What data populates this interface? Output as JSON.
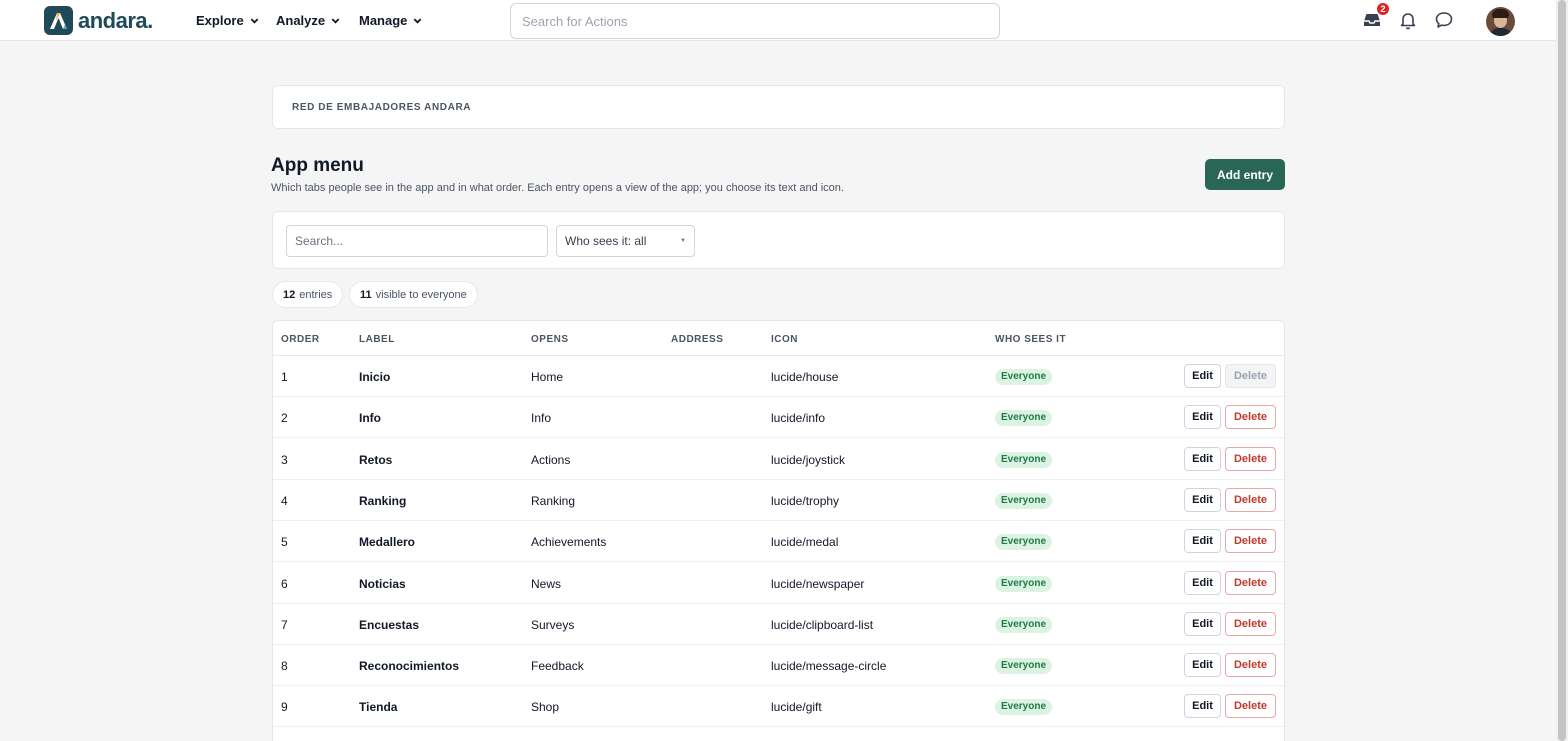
{
  "brand": {
    "name": "andara."
  },
  "nav": {
    "items": [
      {
        "label": "Explore",
        "key": "explore"
      },
      {
        "label": "Analyze",
        "key": "analyze"
      },
      {
        "label": "Manage",
        "key": "manage"
      }
    ],
    "search_placeholder": "Search for Actions",
    "inbox_badge": "2",
    "icons": [
      "inbox-icon",
      "bell-icon",
      "chat-icon"
    ]
  },
  "breadcrumb": {
    "label": "RED DE EMBAJADORES ANDARA"
  },
  "page": {
    "title": "App menu",
    "description": "Which tabs people see in the app and in what order. Each entry opens a view of the app; you choose its text and icon.",
    "add_button": "Add entry"
  },
  "filters": {
    "search_placeholder": "Search...",
    "who_select": "Who sees it: all"
  },
  "stats": {
    "entries_count": "12",
    "entries_label": "entries",
    "visible_count": "11",
    "visible_label": "visible to everyone"
  },
  "table": {
    "columns": {
      "order": "ORDER",
      "label": "LABEL",
      "opens": "OPENS",
      "address": "ADDRESS",
      "icon": "ICON",
      "who": "WHO SEES IT"
    },
    "edit_label": "Edit",
    "delete_label": "Delete",
    "rows": [
      {
        "order": "1",
        "label": "Inicio",
        "opens": "Home",
        "address": "",
        "icon": "lucide/house",
        "who": "Everyone",
        "delete_disabled": true
      },
      {
        "order": "2",
        "label": "Info",
        "opens": "Info",
        "address": "",
        "icon": "lucide/info",
        "who": "Everyone",
        "delete_disabled": false
      },
      {
        "order": "3",
        "label": "Retos",
        "opens": "Actions",
        "address": "",
        "icon": "lucide/joystick",
        "who": "Everyone",
        "delete_disabled": false
      },
      {
        "order": "4",
        "label": "Ranking",
        "opens": "Ranking",
        "address": "",
        "icon": "lucide/trophy",
        "who": "Everyone",
        "delete_disabled": false
      },
      {
        "order": "5",
        "label": "Medallero",
        "opens": "Achievements",
        "address": "",
        "icon": "lucide/medal",
        "who": "Everyone",
        "delete_disabled": false
      },
      {
        "order": "6",
        "label": "Noticias",
        "opens": "News",
        "address": "",
        "icon": "lucide/newspaper",
        "who": "Everyone",
        "delete_disabled": false
      },
      {
        "order": "7",
        "label": "Encuestas",
        "opens": "Surveys",
        "address": "",
        "icon": "lucide/clipboard-list",
        "who": "Everyone",
        "delete_disabled": false
      },
      {
        "order": "8",
        "label": "Reconocimientos",
        "opens": "Feedback",
        "address": "",
        "icon": "lucide/message-circle",
        "who": "Everyone",
        "delete_disabled": false
      },
      {
        "order": "9",
        "label": "Tienda",
        "opens": "Shop",
        "address": "",
        "icon": "lucide/gift",
        "who": "Everyone",
        "delete_disabled": false
      }
    ]
  },
  "colors": {
    "brand": "#1f4a5a",
    "primary_button": "#2a6656",
    "badge_bg": "#dcf2e3",
    "badge_text": "#1f7a45",
    "danger": "#c0392b",
    "notification": "#dc2626"
  }
}
